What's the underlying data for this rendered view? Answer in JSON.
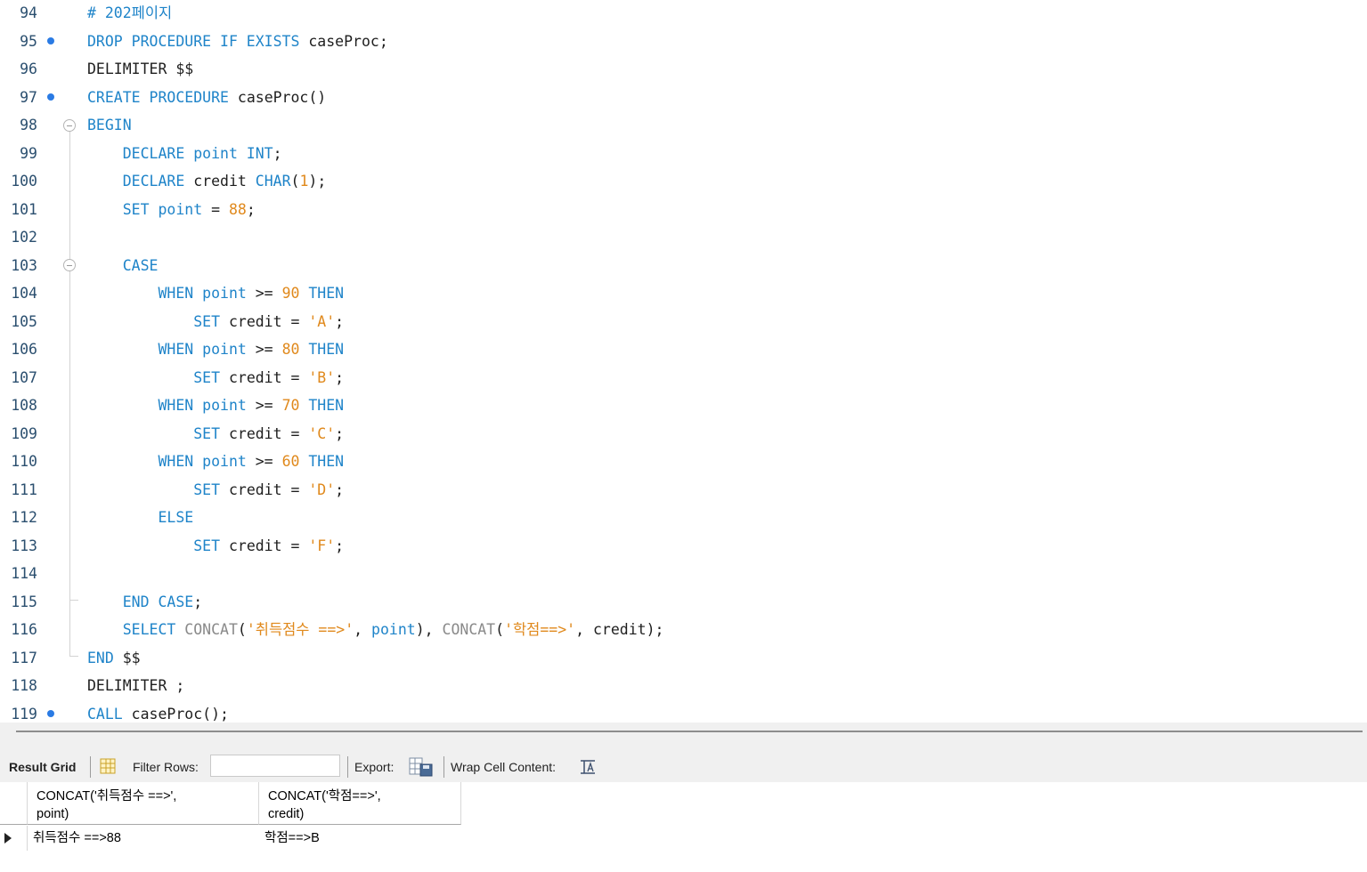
{
  "editor": {
    "lines": [
      {
        "num": "94",
        "dot": false,
        "tokens": [
          {
            "t": "# 202페이지",
            "c": "cmt"
          }
        ]
      },
      {
        "num": "95",
        "dot": true,
        "tokens": [
          {
            "t": "DROP PROCEDURE IF EXISTS",
            "c": "kw"
          },
          {
            "t": " caseProc;",
            "c": "plain"
          }
        ]
      },
      {
        "num": "96",
        "dot": false,
        "tokens": [
          {
            "t": "DELIMITER $$",
            "c": "plain"
          }
        ]
      },
      {
        "num": "97",
        "dot": true,
        "tokens": [
          {
            "t": "CREATE PROCEDURE",
            "c": "kw"
          },
          {
            "t": " caseProc()",
            "c": "plain"
          }
        ]
      },
      {
        "num": "98",
        "dot": false,
        "tokens": [
          {
            "t": "BEGIN",
            "c": "kw"
          }
        ]
      },
      {
        "num": "99",
        "dot": false,
        "tokens": [
          {
            "t": "    DECLARE point INT",
            "c": "kw"
          },
          {
            "t": ";",
            "c": "plain"
          }
        ]
      },
      {
        "num": "100",
        "dot": false,
        "tokens": [
          {
            "t": "    DECLARE",
            "c": "kw"
          },
          {
            "t": " credit ",
            "c": "plain"
          },
          {
            "t": "CHAR",
            "c": "kw"
          },
          {
            "t": "(",
            "c": "plain"
          },
          {
            "t": "1",
            "c": "num"
          },
          {
            "t": ");",
            "c": "plain"
          }
        ]
      },
      {
        "num": "101",
        "dot": false,
        "tokens": [
          {
            "t": "    SET point",
            "c": "kw"
          },
          {
            "t": " = ",
            "c": "plain"
          },
          {
            "t": "88",
            "c": "num"
          },
          {
            "t": ";",
            "c": "plain"
          }
        ]
      },
      {
        "num": "102",
        "dot": false,
        "tokens": []
      },
      {
        "num": "103",
        "dot": false,
        "tokens": [
          {
            "t": "    CASE",
            "c": "kw"
          }
        ]
      },
      {
        "num": "104",
        "dot": false,
        "tokens": [
          {
            "t": "        WHEN point",
            "c": "kw"
          },
          {
            "t": " >= ",
            "c": "plain"
          },
          {
            "t": "90",
            "c": "num"
          },
          {
            "t": " THEN",
            "c": "kw"
          }
        ]
      },
      {
        "num": "105",
        "dot": false,
        "tokens": [
          {
            "t": "            SET",
            "c": "kw"
          },
          {
            "t": " credit = ",
            "c": "plain"
          },
          {
            "t": "'A'",
            "c": "str"
          },
          {
            "t": ";",
            "c": "plain"
          }
        ]
      },
      {
        "num": "106",
        "dot": false,
        "tokens": [
          {
            "t": "        WHEN point",
            "c": "kw"
          },
          {
            "t": " >= ",
            "c": "plain"
          },
          {
            "t": "80",
            "c": "num"
          },
          {
            "t": " THEN",
            "c": "kw"
          }
        ]
      },
      {
        "num": "107",
        "dot": false,
        "tokens": [
          {
            "t": "            SET",
            "c": "kw"
          },
          {
            "t": " credit = ",
            "c": "plain"
          },
          {
            "t": "'B'",
            "c": "str"
          },
          {
            "t": ";",
            "c": "plain"
          }
        ]
      },
      {
        "num": "108",
        "dot": false,
        "tokens": [
          {
            "t": "        WHEN point",
            "c": "kw"
          },
          {
            "t": " >= ",
            "c": "plain"
          },
          {
            "t": "70",
            "c": "num"
          },
          {
            "t": " THEN",
            "c": "kw"
          }
        ]
      },
      {
        "num": "109",
        "dot": false,
        "tokens": [
          {
            "t": "            SET",
            "c": "kw"
          },
          {
            "t": " credit = ",
            "c": "plain"
          },
          {
            "t": "'C'",
            "c": "str"
          },
          {
            "t": ";",
            "c": "plain"
          }
        ]
      },
      {
        "num": "110",
        "dot": false,
        "tokens": [
          {
            "t": "        WHEN point",
            "c": "kw"
          },
          {
            "t": " >= ",
            "c": "plain"
          },
          {
            "t": "60",
            "c": "num"
          },
          {
            "t": " THEN",
            "c": "kw"
          }
        ]
      },
      {
        "num": "111",
        "dot": false,
        "tokens": [
          {
            "t": "            SET",
            "c": "kw"
          },
          {
            "t": " credit = ",
            "c": "plain"
          },
          {
            "t": "'D'",
            "c": "str"
          },
          {
            "t": ";",
            "c": "plain"
          }
        ]
      },
      {
        "num": "112",
        "dot": false,
        "tokens": [
          {
            "t": "        ELSE",
            "c": "kw"
          }
        ]
      },
      {
        "num": "113",
        "dot": false,
        "tokens": [
          {
            "t": "            SET",
            "c": "kw"
          },
          {
            "t": " credit = ",
            "c": "plain"
          },
          {
            "t": "'F'",
            "c": "str"
          },
          {
            "t": ";",
            "c": "plain"
          }
        ]
      },
      {
        "num": "114",
        "dot": false,
        "tokens": []
      },
      {
        "num": "115",
        "dot": false,
        "tokens": [
          {
            "t": "    END CASE",
            "c": "kw"
          },
          {
            "t": ";",
            "c": "plain"
          }
        ]
      },
      {
        "num": "116",
        "dot": false,
        "tokens": [
          {
            "t": "    SELECT",
            "c": "kw"
          },
          {
            "t": " CONCAT",
            "c": "fn"
          },
          {
            "t": "(",
            "c": "plain"
          },
          {
            "t": "'취득점수 ==>'",
            "c": "str"
          },
          {
            "t": ", ",
            "c": "plain"
          },
          {
            "t": "point",
            "c": "kw"
          },
          {
            "t": "), ",
            "c": "plain"
          },
          {
            "t": "CONCAT",
            "c": "fn"
          },
          {
            "t": "(",
            "c": "plain"
          },
          {
            "t": "'학점==>'",
            "c": "str"
          },
          {
            "t": ", credit);",
            "c": "plain"
          }
        ]
      },
      {
        "num": "117",
        "dot": false,
        "tokens": [
          {
            "t": "END",
            "c": "kw"
          },
          {
            "t": " $$",
            "c": "plain"
          }
        ]
      },
      {
        "num": "118",
        "dot": false,
        "tokens": [
          {
            "t": "DELIMITER ;",
            "c": "plain"
          }
        ]
      },
      {
        "num": "119",
        "dot": true,
        "tokens": [
          {
            "t": "CALL",
            "c": "kw"
          },
          {
            "t": " caseProc();",
            "c": "plain"
          }
        ]
      }
    ]
  },
  "toolbar": {
    "result_grid": "Result Grid",
    "filter_rows": "Filter Rows:",
    "filter_value": "",
    "export": "Export:",
    "wrap_cell": "Wrap Cell Content:"
  },
  "grid": {
    "columns": [
      "CONCAT('취득점수 ==>',\npoint)",
      "CONCAT('학점==>',\ncredit)"
    ],
    "rows": [
      [
        "취득점수 ==>88",
        "학점==>B"
      ]
    ]
  },
  "colors": {
    "keyword": "#1f84c9",
    "number": "#e0891c",
    "line_number": "#2b4f6f",
    "breakpoint": "#2a7be4"
  }
}
